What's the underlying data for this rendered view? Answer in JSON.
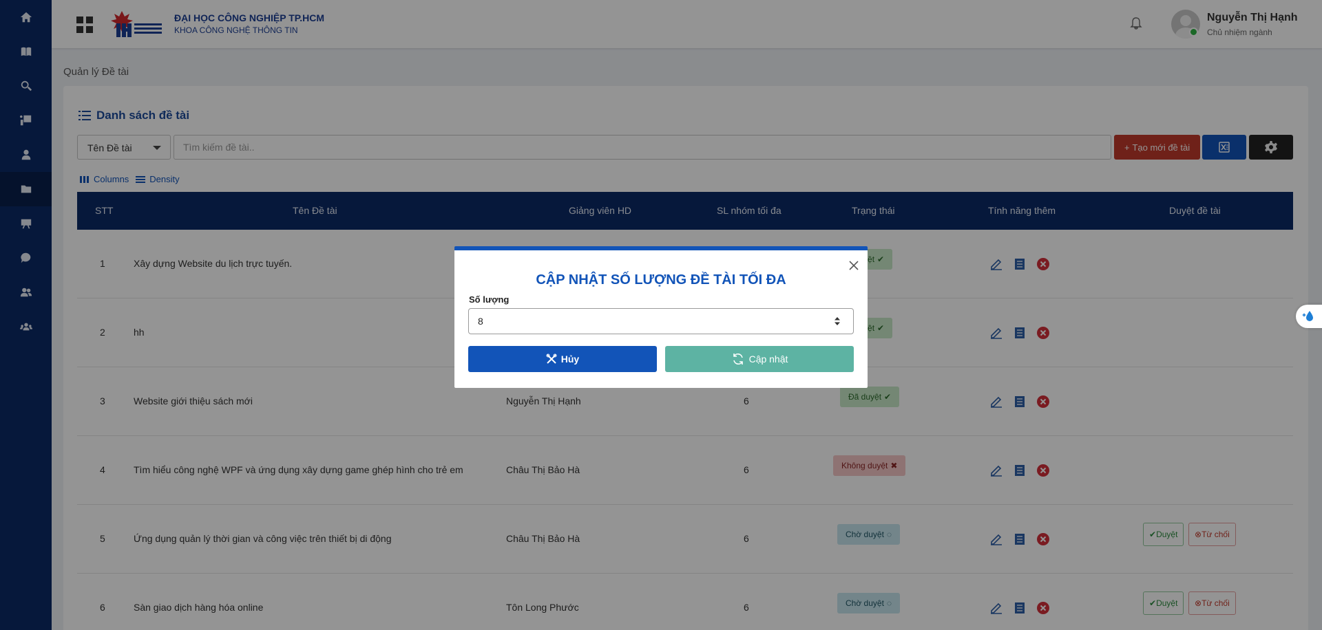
{
  "header": {
    "university": "ĐẠI HỌC CÔNG NGHIỆP TP.HCM",
    "faculty": "KHOA CÔNG NGHỆ THÔNG TIN",
    "user_name": "Nguyễn Thị Hạnh",
    "user_role": "Chủ nhiệm ngành"
  },
  "page": {
    "title": "Quản lý Đề tài"
  },
  "list": {
    "title": "Danh sách đề tài",
    "filter_value": "Tên Đề tài",
    "search_placeholder": "Tìm kiếm đề tài..",
    "create_label": "Tạo mới đề tài",
    "columns_label": "Columns",
    "density_label": "Density"
  },
  "table": {
    "headers": [
      "STT",
      "Tên Đề tài",
      "Giảng viên HD",
      "SL nhóm tối đa",
      "Trạng thái",
      "Tính năng thêm",
      "Duyệt đề tài"
    ],
    "rows": [
      {
        "stt": "1",
        "name": "Xây dựng Website du lịch trực tuyến.",
        "teacher": "",
        "max": "",
        "status": "Đã duyệt",
        "type": "ok"
      },
      {
        "stt": "2",
        "name": "hh",
        "teacher": "",
        "max": "",
        "status": "Đã duyệt",
        "type": "ok"
      },
      {
        "stt": "3",
        "name": "Website giới thiệu sách mới",
        "teacher": "Nguyễn Thị Hạnh",
        "max": "6",
        "status": "Đã duyệt",
        "type": "ok"
      },
      {
        "stt": "4",
        "name": "Tìm hiểu công nghệ WPF và ứng dụng xây dựng game ghép hình cho trẻ em",
        "teacher": "Châu Thị Bảo Hà",
        "max": "6",
        "status": "Không duyệt",
        "type": "no"
      },
      {
        "stt": "5",
        "name": "Ứng dụng quản lý thời gian và công việc trên thiết bị di động",
        "teacher": "Châu Thị Bảo Hà",
        "max": "6",
        "status": "Chờ duyệt",
        "type": "wait"
      },
      {
        "stt": "6",
        "name": "Sàn giao dịch hàng hóa online",
        "teacher": "Tôn Long Phước",
        "max": "6",
        "status": "Chờ duyệt",
        "type": "wait"
      }
    ],
    "approve_label": "Duyệt",
    "reject_label": "Từ chối"
  },
  "modal": {
    "title": "CẬP NHẬT SỐ LƯỢNG ĐỀ TÀI TỐI ĐA",
    "label": "Số lượng",
    "value": "8",
    "cancel_label": "Hủy",
    "update_label": "Cập nhật"
  },
  "colors": {
    "sidebar": "#0c2a66",
    "primary": "#1254b8",
    "danger": "#c0392b",
    "update": "#5db3a3"
  },
  "icons": {
    "sidebar": [
      "home-icon",
      "book-icon",
      "search-icon",
      "presentation-icon",
      "user-tie-icon",
      "folder-icon",
      "chalkboard-icon",
      "comment-icon",
      "users-icon",
      "group-icon"
    ]
  }
}
